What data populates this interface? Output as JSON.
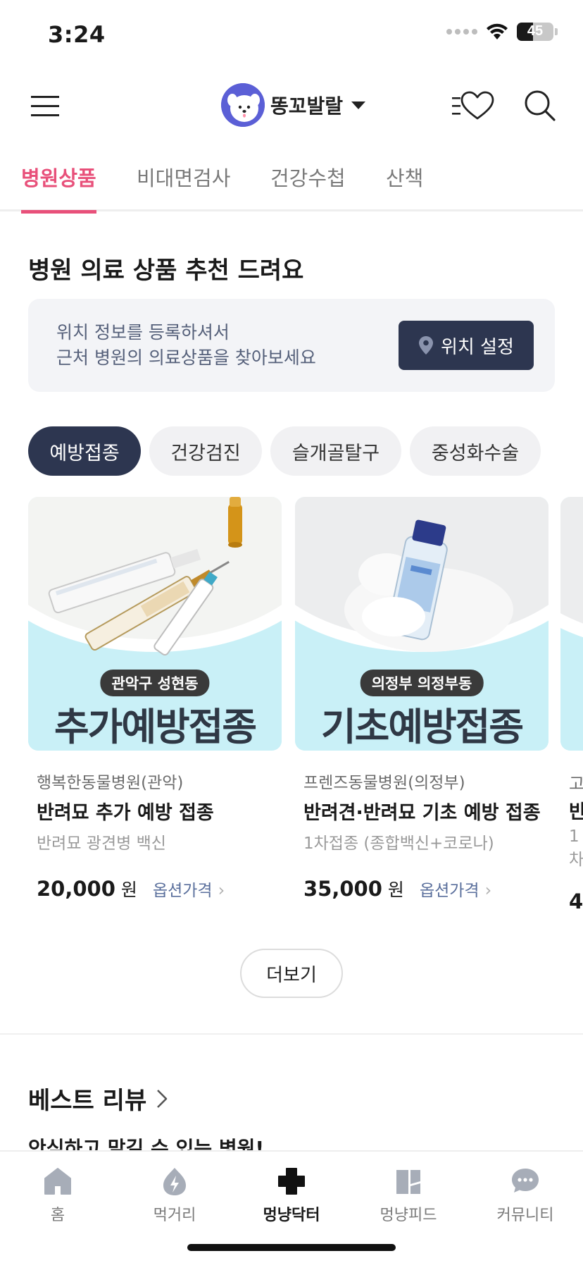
{
  "status_bar": {
    "time": "3:24",
    "battery": "45"
  },
  "header": {
    "profile_name": "똥꼬발랄"
  },
  "tabs": [
    {
      "label": "병원상품",
      "active": true
    },
    {
      "label": "비대면검사",
      "active": false
    },
    {
      "label": "건강수첩",
      "active": false
    },
    {
      "label": "산책",
      "active": false
    }
  ],
  "recommend": {
    "title": "병원 의료 상품 추천 드려요",
    "location_line1": "위치 정보를 등록하셔서",
    "location_line2": "근처 병원의 의료상품을 찾아보세요",
    "location_button": "위치 설정"
  },
  "chips": [
    {
      "label": "예방접종",
      "active": true
    },
    {
      "label": "건강검진",
      "active": false
    },
    {
      "label": "슬개골탈구",
      "active": false
    },
    {
      "label": "중성화수술",
      "active": false
    }
  ],
  "products": [
    {
      "badge": "관악구 성현동",
      "banner": "추가예방접종",
      "hospital": "행복한동물병원(관악)",
      "title": "반려묘 추가 예방 접종",
      "subtitle": "반려묘 광견병 백신",
      "price": "20,000",
      "currency": "원",
      "option_label": "옵션가격"
    },
    {
      "badge": "의정부 의정부동",
      "banner": "기초예방접종",
      "hospital": "프렌즈동물병원(의정부)",
      "title": "반려견·반려묘 기초 예방 접종",
      "subtitle": "1차접종 (종합백신+코로나)",
      "price": "35,000",
      "currency": "원",
      "option_label": "옵션가격"
    }
  ],
  "peek_card": {
    "hospital": "고",
    "title": "반",
    "subtitle": "1차",
    "price": "4"
  },
  "more_button": "더보기",
  "best_review": {
    "title": "베스트 리뷰",
    "peek_text": "안심하고 맡길 수 있는 병원!"
  },
  "bottom_nav": [
    {
      "label": "홈",
      "icon": "home-icon",
      "active": false
    },
    {
      "label": "먹거리",
      "icon": "food-icon",
      "active": false
    },
    {
      "label": "멍냥닥터",
      "icon": "medical-cross-icon",
      "active": true
    },
    {
      "label": "멍냥피드",
      "icon": "feed-icon",
      "active": false
    },
    {
      "label": "커뮤니티",
      "icon": "chat-bubble-icon",
      "active": false
    }
  ],
  "colors": {
    "accent_pink": "#e8507a",
    "navy": "#2d3650",
    "banner_cyan": "#c9f0f7"
  }
}
